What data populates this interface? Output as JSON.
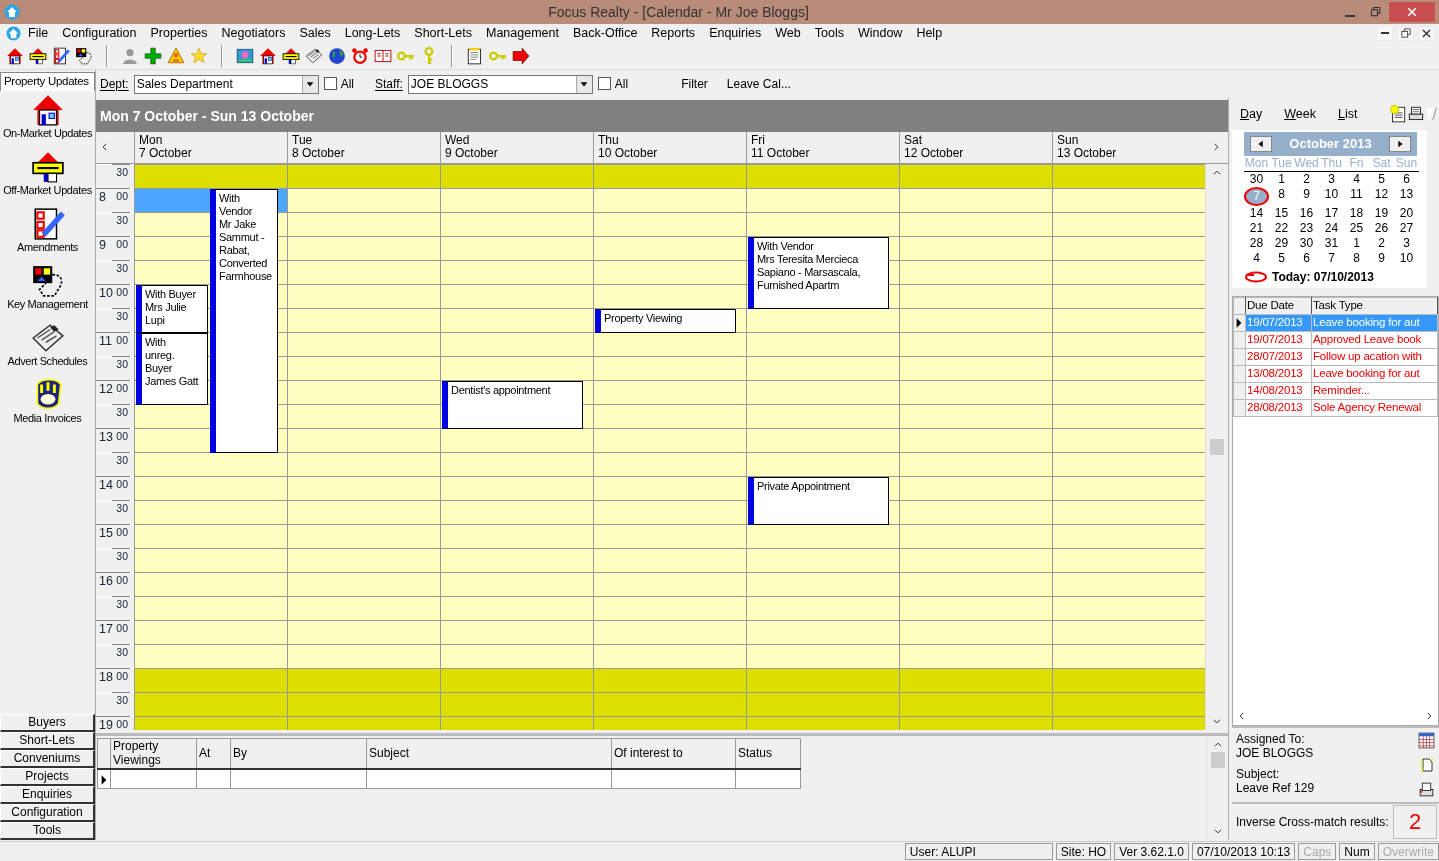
{
  "window": {
    "title": "Focus Realty - [Calendar - Mr Joe Bloggs]"
  },
  "menu": [
    "File",
    "Configuration",
    "Properties",
    "Negotiators",
    "Sales",
    "Long-Lets",
    "Short-Lets",
    "Management",
    "Back-Office",
    "Reports",
    "Enquiries",
    "Web",
    "Tools",
    "Window",
    "Help"
  ],
  "toolbar": [
    {
      "kind": "house"
    },
    {
      "kind": "sold"
    },
    {
      "kind": "checklist"
    },
    {
      "kind": "keycard"
    },
    {
      "kind": "separator"
    },
    {
      "kind": "person"
    },
    {
      "kind": "cross"
    },
    {
      "kind": "warning"
    },
    {
      "kind": "star"
    },
    {
      "kind": "separator"
    },
    {
      "kind": "picture"
    },
    {
      "kind": "house"
    },
    {
      "kind": "sold"
    },
    {
      "kind": "newspaper"
    },
    {
      "kind": "globe"
    },
    {
      "kind": "alarm"
    },
    {
      "kind": "book"
    },
    {
      "kind": "keys"
    },
    {
      "kind": "key"
    },
    {
      "kind": "separator"
    },
    {
      "kind": "notepad"
    },
    {
      "kind": "keys"
    },
    {
      "kind": "go"
    }
  ],
  "filter": {
    "dept_label": "Dept:",
    "dept": "Sales Department",
    "dept_all": {
      "label": "All",
      "checked": false
    },
    "staff_label": "Staff:",
    "staff": "JOE BLOGGS",
    "staff_all": {
      "label": "All",
      "checked": false
    },
    "buttons": [
      "Filter",
      "Leave Cal..."
    ]
  },
  "sidebar": {
    "items": [
      {
        "label": "On-Market Updates",
        "kind": "house"
      },
      {
        "label": "Off-Market Updates",
        "kind": "sold"
      },
      {
        "label": "Amendments",
        "kind": "checklist"
      },
      {
        "label": "Key Management",
        "kind": "keycard"
      },
      {
        "label": "Advert Schedules",
        "kind": "newspaper"
      },
      {
        "label": "Media Invoices",
        "kind": "mitt"
      }
    ],
    "tabs": [
      {
        "label": "Property Updates",
        "selected": true
      },
      {
        "label": "Buyers",
        "selected": false
      },
      {
        "label": "Short-Lets",
        "selected": false
      },
      {
        "label": "Conveniums",
        "selected": false
      },
      {
        "label": "Projects",
        "selected": false
      },
      {
        "label": "Enquiries",
        "selected": false
      },
      {
        "label": "Configuration",
        "selected": false
      },
      {
        "label": "Tools",
        "selected": false
      }
    ]
  },
  "calendar": {
    "range_title": "Mon 7 October - Sun 13 October",
    "time_rows": [
      {
        "minutes": "30",
        "working": false
      },
      {
        "hour": "8",
        "minutes": "00",
        "working": true
      },
      {
        "minutes": "30",
        "working": true
      },
      {
        "hour": "9",
        "minutes": "00",
        "working": true
      },
      {
        "minutes": "30",
        "working": true
      },
      {
        "hour": "10",
        "minutes": "00",
        "working": true
      },
      {
        "minutes": "30",
        "working": true
      },
      {
        "hour": "11",
        "minutes": "00",
        "working": true
      },
      {
        "minutes": "30",
        "working": true
      },
      {
        "hour": "12",
        "minutes": "00",
        "working": true
      },
      {
        "minutes": "30",
        "working": true
      },
      {
        "hour": "13",
        "minutes": "00",
        "working": true
      },
      {
        "minutes": "30",
        "working": true
      },
      {
        "hour": "14",
        "minutes": "00",
        "working": true
      },
      {
        "minutes": "30",
        "working": true
      },
      {
        "hour": "15",
        "minutes": "00",
        "working": true
      },
      {
        "minutes": "30",
        "working": true
      },
      {
        "hour": "16",
        "minutes": "00",
        "working": true
      },
      {
        "minutes": "30",
        "working": true
      },
      {
        "hour": "17",
        "minutes": "00",
        "working": true
      },
      {
        "minutes": "30",
        "working": true
      },
      {
        "hour": "18",
        "minutes": "00",
        "working": false
      },
      {
        "minutes": "30",
        "working": false
      },
      {
        "hour": "19",
        "minutes": "00",
        "working": false
      }
    ],
    "days": [
      {
        "weekday": "Mon",
        "date": "7 October",
        "slot_selected": true,
        "events": [
          {
            "text": "With Buyer\nMrs Julie\nLupi"
          },
          {
            "text": "With\nunreg.\nBuyer\nJames Gatt"
          },
          {
            "text": "With\nVendor\nMr Jake\nSammut -\nRabat,\nConverted\nFarmhouse"
          }
        ]
      },
      {
        "weekday": "Tue",
        "date": "8 October",
        "slot_selected": false
      },
      {
        "weekday": "Wed",
        "date": "9 October",
        "slot_selected": false,
        "events": [
          {
            "text": "Dentist's appointment"
          }
        ]
      },
      {
        "weekday": "Thu",
        "date": "10 October",
        "slot_selected": false,
        "events": [
          {
            "text": "Property Viewing"
          }
        ]
      },
      {
        "weekday": "Fri",
        "date": "11 October",
        "slot_selected": false,
        "events": [
          {
            "text": "With Vendor\nMrs Teresita Mercieca\nSapiano - Marsascala,\nFurnished Apartm"
          },
          {
            "text": "Private Appointment"
          }
        ]
      },
      {
        "weekday": "Sat",
        "date": "12 October",
        "slot_selected": false
      },
      {
        "weekday": "Sun",
        "date": "13 October",
        "slot_selected": false
      }
    ]
  },
  "viewings": {
    "columns": [
      "Property Viewings",
      "At",
      "By",
      "Subject",
      "Of interest to",
      "Status"
    ]
  },
  "right_panel": {
    "views": [
      "Day",
      "Week",
      "List"
    ],
    "mini_calendar": {
      "title": "October 2013",
      "weekdays": [
        "Mon",
        "Tue",
        "Wed",
        "Thu",
        "Fri",
        "Sat",
        "Sun"
      ],
      "weeks": [
        [
          {
            "day": "30",
            "today": false
          },
          {
            "day": "1",
            "today": false
          },
          {
            "day": "2",
            "today": false
          },
          {
            "day": "3",
            "today": false
          },
          {
            "day": "4",
            "today": false
          },
          {
            "day": "5",
            "today": false
          },
          {
            "day": "6",
            "today": false
          }
        ],
        [
          {
            "day": "7",
            "today": true
          },
          {
            "day": "8",
            "today": false
          },
          {
            "day": "9",
            "today": false
          },
          {
            "day": "10",
            "today": false
          },
          {
            "day": "11",
            "today": false
          },
          {
            "day": "12",
            "today": false
          },
          {
            "day": "13",
            "today": false
          }
        ],
        [
          {
            "day": "14",
            "today": false
          },
          {
            "day": "15",
            "today": false
          },
          {
            "day": "16",
            "today": false
          },
          {
            "day": "17",
            "today": false
          },
          {
            "day": "18",
            "today": false
          },
          {
            "day": "19",
            "today": false
          },
          {
            "day": "20",
            "today": false
          }
        ],
        [
          {
            "day": "21",
            "today": false
          },
          {
            "day": "22",
            "today": false
          },
          {
            "day": "23",
            "today": false
          },
          {
            "day": "24",
            "today": false
          },
          {
            "day": "25",
            "today": false
          },
          {
            "day": "26",
            "today": false
          },
          {
            "day": "27",
            "today": false
          }
        ],
        [
          {
            "day": "28",
            "today": false
          },
          {
            "day": "29",
            "today": false
          },
          {
            "day": "30",
            "today": false
          },
          {
            "day": "31",
            "today": false
          },
          {
            "day": "1",
            "today": false
          },
          {
            "day": "2",
            "today": false
          },
          {
            "day": "3",
            "today": false
          }
        ],
        [
          {
            "day": "4",
            "today": false
          },
          {
            "day": "5",
            "today": false
          },
          {
            "day": "6",
            "today": false
          },
          {
            "day": "7",
            "today": false
          },
          {
            "day": "8",
            "today": false
          },
          {
            "day": "9",
            "today": false
          },
          {
            "day": "10",
            "today": false
          }
        ]
      ],
      "today_label": "Today: 07/10/2013"
    },
    "tasks": {
      "columns": [
        "Due Date",
        "Task Type"
      ],
      "rows": [
        {
          "due": "19/07/2013",
          "type": "Leave booking for aut",
          "selected": true
        },
        {
          "due": "19/07/2013",
          "type": "Approved Leave book",
          "selected": false
        },
        {
          "due": "28/07/2013",
          "type": "Follow up acation with",
          "selected": false
        },
        {
          "due": "13/08/2013",
          "type": "Leave booking for aut",
          "selected": false
        },
        {
          "due": "14/08/2013",
          "type": "Reminder...",
          "selected": false
        },
        {
          "due": "28/08/2013",
          "type": "Sole Agency Renewal",
          "selected": false
        }
      ]
    },
    "details": {
      "assigned_label": "Assigned To:",
      "assigned": "JOE BLOGGS",
      "subject_label": "Subject:",
      "subject": "Leave Ref 129",
      "cross_match_label": "Inverse Cross-match results:",
      "cross_match_count": "2"
    }
  },
  "status_bar": [
    {
      "text": "User: ALUPI",
      "disabled": false
    },
    {
      "text": "Site: HO",
      "disabled": false
    },
    {
      "text": "Ver 3.62.1.0",
      "disabled": false
    },
    {
      "text": "07/10/2013 10:13",
      "disabled": false
    },
    {
      "text": "Caps",
      "disabled": true
    },
    {
      "text": "Num",
      "disabled": false
    },
    {
      "text": "Overwrite",
      "disabled": true
    }
  ]
}
